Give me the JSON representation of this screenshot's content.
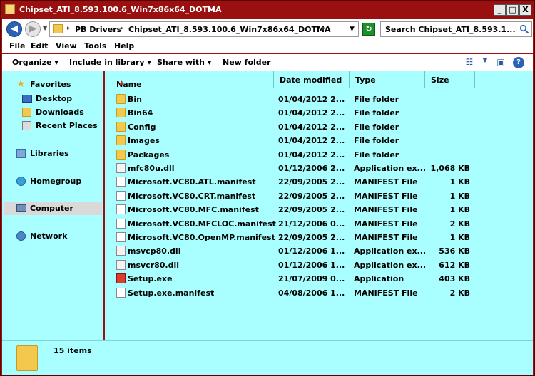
{
  "window": {
    "title": "Chipset_ATI_8.593.100.6_Win7x86x64_DOTMA",
    "minimize": "_",
    "maximize": "□",
    "close": "X"
  },
  "address": {
    "back_glyph": "◀",
    "forward_glyph": "▶",
    "breadcrumbs": [
      "PB Drivers",
      "Chipset_ATI_8.593.100.6_Win7x86x64_DOTMA"
    ],
    "refresh_glyph": "↻",
    "search_text": "Search Chipset_ATI_8.593.1..."
  },
  "menu": {
    "file": "File",
    "edit": "Edit",
    "view": "View",
    "tools": "Tools",
    "help": "Help"
  },
  "toolbar": {
    "organize": "Organize",
    "include": "Include in library",
    "share": "Share with",
    "new_folder": "New folder"
  },
  "nav": {
    "favorites": "Favorites",
    "desktop": "Desktop",
    "downloads": "Downloads",
    "recent": "Recent Places",
    "libraries": "Libraries",
    "homegroup": "Homegroup",
    "computer": "Computer",
    "network": "Network"
  },
  "columns": {
    "name": "Name",
    "date": "Date modified",
    "type": "Type",
    "size": "Size"
  },
  "files": [
    {
      "name": "Bin",
      "date": "01/04/2012 2...",
      "type": "File folder",
      "size": "",
      "icon": "folder"
    },
    {
      "name": "Bin64",
      "date": "01/04/2012 2...",
      "type": "File folder",
      "size": "",
      "icon": "folder"
    },
    {
      "name": "Config",
      "date": "01/04/2012 2...",
      "type": "File folder",
      "size": "",
      "icon": "folder"
    },
    {
      "name": "Images",
      "date": "01/04/2012 2...",
      "type": "File folder",
      "size": "",
      "icon": "folder"
    },
    {
      "name": "Packages",
      "date": "01/04/2012 2...",
      "type": "File folder",
      "size": "",
      "icon": "folder"
    },
    {
      "name": "mfc80u.dll",
      "date": "01/12/2006 2...",
      "type": "Application ex...",
      "size": "1,068 KB",
      "icon": "dll"
    },
    {
      "name": "Microsoft.VC80.ATL.manifest",
      "date": "22/09/2005 2...",
      "type": "MANIFEST File",
      "size": "1 KB",
      "icon": "doc"
    },
    {
      "name": "Microsoft.VC80.CRT.manifest",
      "date": "22/09/2005 2...",
      "type": "MANIFEST File",
      "size": "1 KB",
      "icon": "doc"
    },
    {
      "name": "Microsoft.VC80.MFC.manifest",
      "date": "22/09/2005 2...",
      "type": "MANIFEST File",
      "size": "1 KB",
      "icon": "doc"
    },
    {
      "name": "Microsoft.VC80.MFCLOC.manifest",
      "date": "21/12/2006 0...",
      "type": "MANIFEST File",
      "size": "2 KB",
      "icon": "doc"
    },
    {
      "name": "Microsoft.VC80.OpenMP.manifest",
      "date": "22/09/2005 2...",
      "type": "MANIFEST File",
      "size": "1 KB",
      "icon": "doc"
    },
    {
      "name": "msvcp80.dll",
      "date": "01/12/2006 1...",
      "type": "Application ex...",
      "size": "536 KB",
      "icon": "dll"
    },
    {
      "name": "msvcr80.dll",
      "date": "01/12/2006 1...",
      "type": "Application ex...",
      "size": "612 KB",
      "icon": "dll"
    },
    {
      "name": "Setup.exe",
      "date": "21/07/2009 0...",
      "type": "Application",
      "size": "403 KB",
      "icon": "exe"
    },
    {
      "name": "Setup.exe.manifest",
      "date": "04/08/2006 1...",
      "type": "MANIFEST File",
      "size": "2 KB",
      "icon": "doc"
    }
  ],
  "status": {
    "item_count": "15 items"
  },
  "colors": {
    "titlebar": "#9a0f0f",
    "pane_background": "#a9ffff"
  }
}
